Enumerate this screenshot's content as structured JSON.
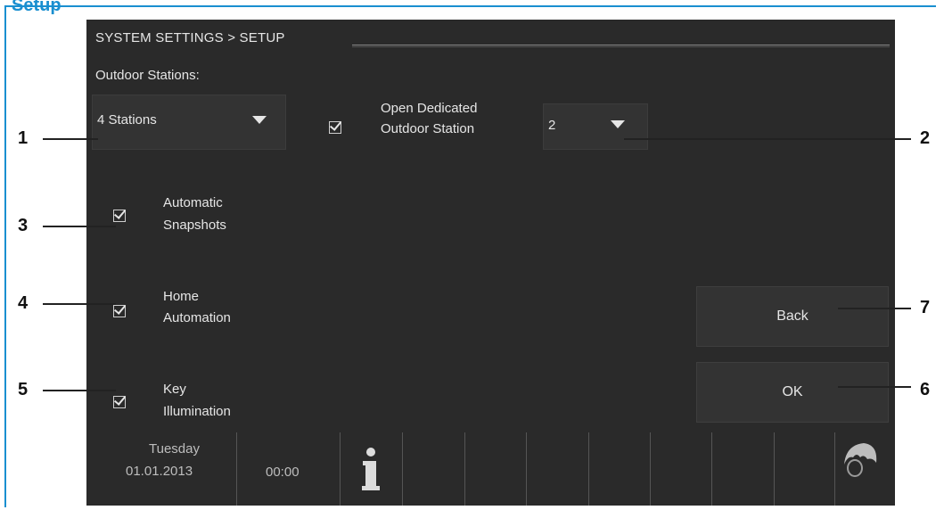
{
  "page_title": "Setup",
  "breadcrumb": "SYSTEM SETTINGS > SETUP",
  "outdoor_stations": {
    "label": "Outdoor Stations:",
    "selected": "4 Stations"
  },
  "open_dedicated": {
    "label_line1": "Open Dedicated",
    "label_line2": "Outdoor Station",
    "selected": "2",
    "checked": true
  },
  "options": [
    {
      "line1": "Automatic",
      "line2": "Snapshots",
      "checked": true
    },
    {
      "line1": "Home",
      "line2": "Automation",
      "checked": true
    },
    {
      "line1": "Key",
      "line2": "Illumination",
      "checked": true
    }
  ],
  "buttons": {
    "back": "Back",
    "ok": "OK"
  },
  "statusbar": {
    "day": "Tuesday",
    "date": "01.01.2013",
    "time": "00:00",
    "info_icon": "info-icon",
    "hand_icon": "hand-icon"
  },
  "callouts": [
    "1",
    "2",
    "3",
    "4",
    "5",
    "6",
    "7"
  ],
  "colors": {
    "accent": "#1a8fd0",
    "screen_bg": "#2a2a2a",
    "text": "#e6e6e6"
  }
}
